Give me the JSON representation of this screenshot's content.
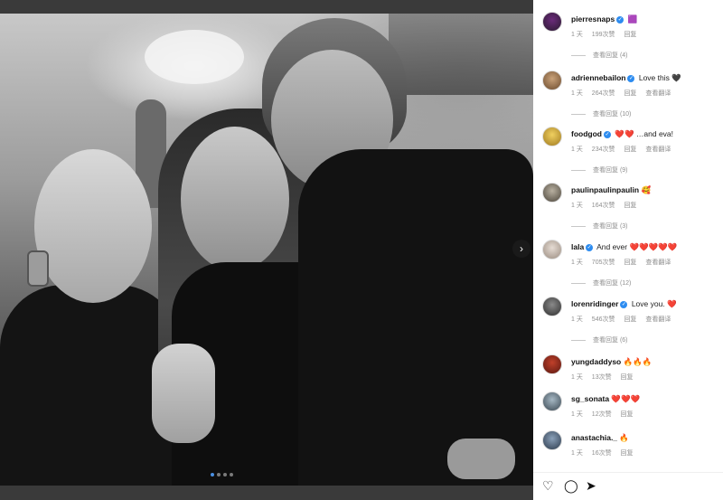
{
  "post": {
    "carousel_dots": 4,
    "active_dot": 0,
    "next_arrow": "›"
  },
  "comments": [
    {
      "user": "pierresnaps",
      "verified": true,
      "text": "",
      "emoji": "🟪",
      "time": "1 天",
      "likes": "199次赞",
      "reply": "回复",
      "view_replies": "查看回复 (4)"
    },
    {
      "user": "adriennebailon",
      "verified": true,
      "text": "Love this",
      "emoji": "🖤",
      "time": "1 天",
      "likes": "264次赞",
      "reply": "回复",
      "translate": "查看翻译",
      "view_replies": "查看回复 (10)"
    },
    {
      "user": "foodgod",
      "verified": true,
      "text": "…and eva!",
      "emoji": "❤️❤️",
      "time": "1 天",
      "likes": "234次赞",
      "reply": "回复",
      "translate": "查看翻译",
      "view_replies": "查看回复 (9)"
    },
    {
      "user": "paulinpaulinpaulin",
      "verified": false,
      "text": "",
      "emoji": "🥰",
      "time": "1 天",
      "likes": "164次赞",
      "reply": "回复",
      "view_replies": "查看回复 (3)"
    },
    {
      "user": "lala",
      "verified": true,
      "text": "And ever",
      "emoji": "❤️❤️❤️❤️❤️",
      "time": "1 天",
      "likes": "705次赞",
      "reply": "回复",
      "translate": "查看翻译",
      "view_replies": "查看回复 (12)"
    },
    {
      "user": "lorenridinger",
      "verified": true,
      "text": "Love you.",
      "emoji": "❤️",
      "time": "1 天",
      "likes": "546次赞",
      "reply": "回复",
      "translate": "查看翻译",
      "view_replies": "查看回复 (6)"
    },
    {
      "user": "yungdaddyso",
      "verified": false,
      "text": "",
      "emoji": "🔥🔥🔥",
      "time": "1 天",
      "likes": "13次赞",
      "reply": "回复"
    },
    {
      "user": "sg_sonata",
      "verified": false,
      "text": "",
      "emoji": "❤️❤️❤️",
      "time": "1 天",
      "likes": "12次赞",
      "reply": "回复"
    },
    {
      "user": "anastachia._",
      "verified": false,
      "text": "",
      "emoji": "🔥",
      "time": "1 天",
      "likes": "16次赞",
      "reply": "回复"
    }
  ],
  "colors": {
    "verified": "#2d8cf0",
    "heart": "#c8102e",
    "meta_text": "#8e8e8e"
  }
}
